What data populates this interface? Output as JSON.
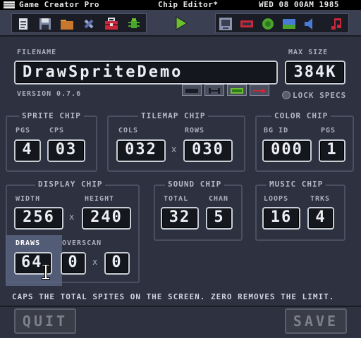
{
  "menubar": {
    "app_name": "Game Creator Pro",
    "window_title": "Chip Editor*",
    "clock": "WED 08 00AM 1985"
  },
  "toolbar": {
    "left_group": [
      "file-icon",
      "save-icon",
      "folder-icon",
      "tools-icon",
      "briefcase-icon",
      "bug-icon"
    ],
    "run": "play-icon",
    "right_group": [
      "computer-icon",
      "sprite-icon",
      "tilemap-icon",
      "landscape-icon",
      "sound-icon",
      "music-icon"
    ],
    "colors": {
      "bg": "#3a3f52",
      "play": "#6dbf2d",
      "red": "#c8283a",
      "green": "#49a52c",
      "folder": "#c7782d"
    }
  },
  "header": {
    "filename_label": "FILENAME",
    "filename_value": "DrawSpriteDemo",
    "maxsize_label": "MAX SIZE",
    "maxsize_value": "384K",
    "version_label": "VERSION",
    "version_value": "0.7.6",
    "lock_label": "LOCK SPECS"
  },
  "sprite_chip": {
    "title": "SPRITE CHIP",
    "pgs_label": "PGS",
    "pgs_value": "4",
    "cps_label": "CPS",
    "cps_value": "03"
  },
  "tilemap_chip": {
    "title": "TILEMAP CHIP",
    "cols_label": "COLS",
    "cols_value": "032",
    "rows_label": "ROWS",
    "rows_value": "030",
    "sep": "x"
  },
  "color_chip": {
    "title": "COLOR CHIP",
    "bgid_label": "BG ID",
    "bgid_value": "000",
    "pgs_label": "PGS",
    "pgs_value": "1"
  },
  "display_chip": {
    "title": "DISPLAY CHIP",
    "width_label": "WIDTH",
    "width_value": "256",
    "height_label": "HEIGHT",
    "height_value": "240",
    "sep": "x",
    "draws_label": "DRAWS",
    "draws_value": "64",
    "overscan_label": "OVERSCAN",
    "overscan_x": "0",
    "overscan_y": "0"
  },
  "sound_chip": {
    "title": "SOUND CHIP",
    "total_label": "TOTAL",
    "total_value": "32",
    "chan_label": "CHAN",
    "chan_value": "5"
  },
  "music_chip": {
    "title": "MUSIC CHIP",
    "loops_label": "LOOPS",
    "loops_value": "16",
    "trks_label": "TRKS",
    "trks_value": "4"
  },
  "hint": "CAPS THE TOTAL SPITES ON THE SCREEN. ZERO REMOVES THE LIMIT.",
  "footer": {
    "quit_label": "QUIT",
    "save_label": "SAVE"
  }
}
